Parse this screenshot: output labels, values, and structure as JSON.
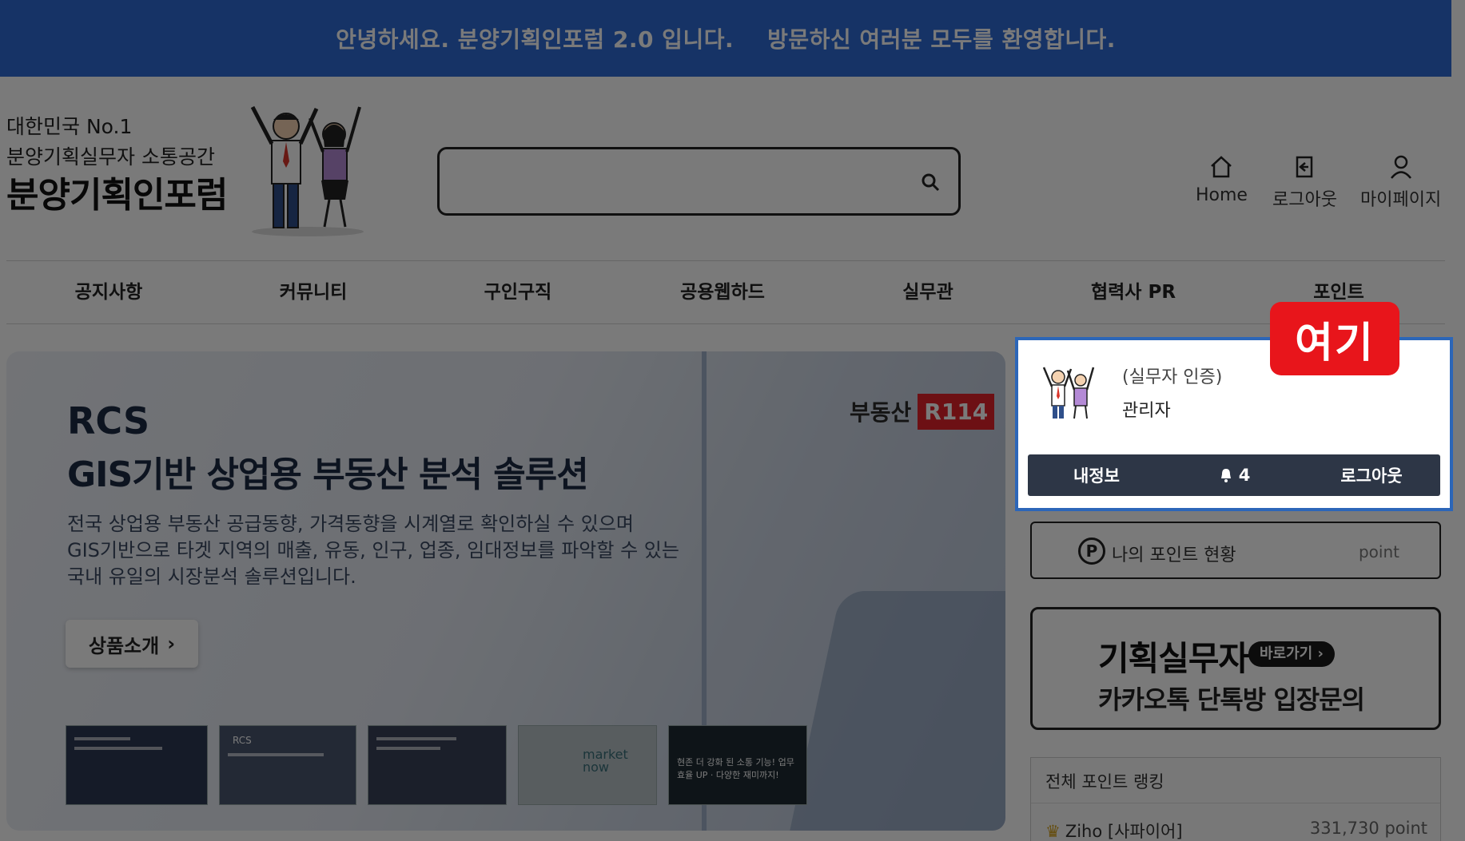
{
  "topbar": {
    "message_1": "안녕하세요. 분양기획인포럼 2.0 입니다.",
    "message_2": "방문하신 여러분 모두를 환영합니다."
  },
  "logo": {
    "line_1": "대한민국 No.1",
    "line_2": "분양기획실무자 소통공간",
    "brand": "분양기획인포럼"
  },
  "search": {
    "value": "",
    "placeholder": ""
  },
  "header_links": {
    "home": "Home",
    "logout": "로그아웃",
    "mypage": "마이페이지"
  },
  "nav": [
    "공지사항",
    "커뮤니티",
    "구인구직",
    "공용웹하드",
    "실무관",
    "협력사 PR",
    "포인트"
  ],
  "hero": {
    "title_1": "RCS",
    "title_2": "GIS기반 상업용 부동산 분석 솔루션",
    "desc": [
      "전국 상업용 부동산 공급동향, 가격동향을 시계열로 확인하실 수 있으며",
      "GIS기반으로 타겟 지역의 매출, 유동, 인구, 업종, 임대정보를 파악할 수 있는",
      "국내 유일의 시장분석 솔루션입니다."
    ],
    "cta": "상품소개",
    "brand_text": "부동산",
    "brand_badge": "R114",
    "thumb_captions": [
      "",
      "RCS",
      "",
      "market now",
      "현존 더 강화 된 소통 기능! 업무효율 UP · 다양한 재미까지!"
    ]
  },
  "user_card": {
    "cert": "(실무자 인증)",
    "name": "관리자",
    "my_info": "내정보",
    "notifications": "4",
    "logout": "로그아웃"
  },
  "callout": "여기",
  "points": {
    "icon_letter": "P",
    "label": "나의 포인트 현황",
    "unit": "point"
  },
  "kakao": {
    "title": "기획실무자",
    "button": "바로가기 ›",
    "subtitle": "카카오톡 단톡방 입장문의"
  },
  "ranking": {
    "title": "전체 포인트 랭킹",
    "first_name": "Ziho [사파이어]",
    "first_points": "331,730 point"
  },
  "colors": {
    "topbar": "#2f6bd6",
    "callout": "#e8151b",
    "card_border": "#2c66b8",
    "card_bar": "#2d3646"
  }
}
